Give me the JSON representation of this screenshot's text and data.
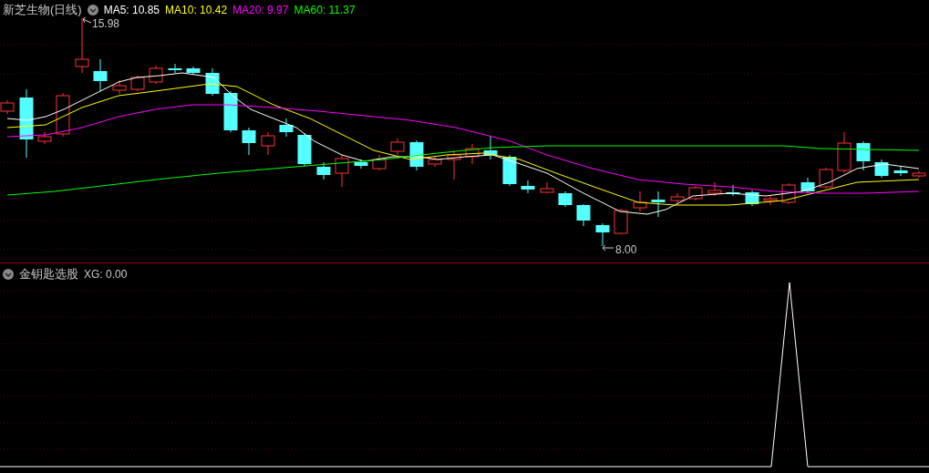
{
  "chart": {
    "title": "新芝生物(日线)",
    "indicators": [
      {
        "label": "MA5: 10.85",
        "color": "#ffffff"
      },
      {
        "label": "MA10: 10.42",
        "color": "#ffff00"
      },
      {
        "label": "MA20: 9.97",
        "color": "#ff00ff"
      },
      {
        "label": "MA60: 11.37",
        "color": "#00ff00"
      }
    ],
    "high_label": "15.98",
    "low_label": "8.00"
  },
  "indicator_panel": {
    "title": "金钥匙选股",
    "reading": "XG: 0.00"
  }
}
